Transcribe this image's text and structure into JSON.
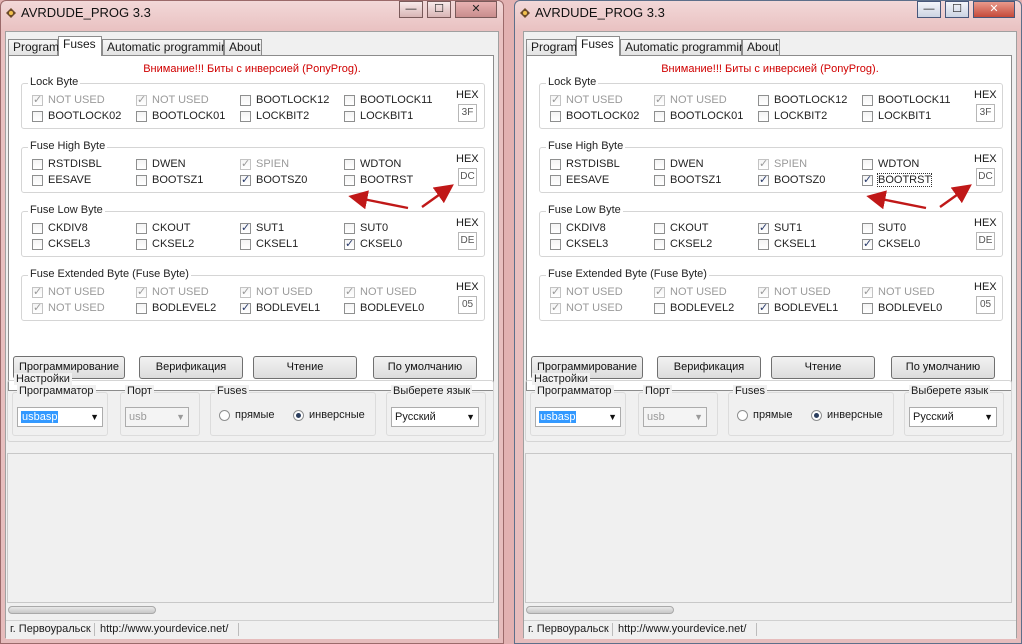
{
  "window": {
    "title": "AVRDUDE_PROG 3.3",
    "minimize_glyph": "—",
    "maximize_glyph": "☐",
    "close_glyph": "✕"
  },
  "tabs": [
    {
      "label": "Program"
    },
    {
      "label": "Fuses"
    },
    {
      "label": "Automatic programming"
    },
    {
      "label": "About"
    }
  ],
  "fuses": {
    "warning": "Внимание!!! Биты с инверсией (PonyProg).",
    "hex_label": "HEX"
  },
  "buttons": {
    "program": "Программирование",
    "verify": "Верификация",
    "read": "Чтение",
    "default": "По умолчанию"
  },
  "settings": {
    "legend": "Настройки",
    "programmer_label": "Программатор",
    "programmer_value": "usbasp",
    "port_label": "Порт",
    "port_value": "usb",
    "fuses_label": "Fuses",
    "radio_direct": "прямые",
    "radio_inverse": "инверсные",
    "language_label": "Выберете язык",
    "language_value": "Русский"
  },
  "status": {
    "city": "г. Первоуральск",
    "url": "http://www.yourdevice.net/"
  },
  "windows": [
    {
      "groups": [
        {
          "legend": "Lock Byte",
          "hex": "3F",
          "bits": [
            {
              "label": "NOT USED",
              "checked": true,
              "disabled": true
            },
            {
              "label": "NOT USED",
              "checked": true,
              "disabled": true
            },
            {
              "label": "BOOTLOCK12",
              "checked": false,
              "disabled": false
            },
            {
              "label": "BOOTLOCK11",
              "checked": false,
              "disabled": false
            },
            {
              "label": "BOOTLOCK02",
              "checked": false,
              "disabled": false
            },
            {
              "label": "BOOTLOCK01",
              "checked": false,
              "disabled": false
            },
            {
              "label": "LOCKBIT2",
              "checked": false,
              "disabled": false
            },
            {
              "label": "LOCKBIT1",
              "checked": false,
              "disabled": false
            }
          ]
        },
        {
          "legend": "Fuse High Byte",
          "hex": "DC",
          "bits": [
            {
              "label": "RSTDISBL",
              "checked": false,
              "disabled": false
            },
            {
              "label": "DWEN",
              "checked": false,
              "disabled": false
            },
            {
              "label": "SPIEN",
              "checked": true,
              "disabled": true
            },
            {
              "label": "WDTON",
              "checked": false,
              "disabled": false
            },
            {
              "label": "EESAVE",
              "checked": false,
              "disabled": false
            },
            {
              "label": "BOOTSZ1",
              "checked": false,
              "disabled": false
            },
            {
              "label": "BOOTSZ0",
              "checked": true,
              "disabled": false
            },
            {
              "label": "BOOTRST",
              "checked": false,
              "disabled": false
            }
          ]
        },
        {
          "legend": "Fuse Low Byte",
          "hex": "DE",
          "bits": [
            {
              "label": "CKDIV8",
              "checked": false,
              "disabled": false
            },
            {
              "label": "CKOUT",
              "checked": false,
              "disabled": false
            },
            {
              "label": "SUT1",
              "checked": true,
              "disabled": false
            },
            {
              "label": "SUT0",
              "checked": false,
              "disabled": false
            },
            {
              "label": "CKSEL3",
              "checked": false,
              "disabled": false
            },
            {
              "label": "CKSEL2",
              "checked": false,
              "disabled": false
            },
            {
              "label": "CKSEL1",
              "checked": false,
              "disabled": false
            },
            {
              "label": "CKSEL0",
              "checked": true,
              "disabled": false
            }
          ]
        },
        {
          "legend": "Fuse Extended Byte (Fuse Byte)",
          "hex": "05",
          "bits": [
            {
              "label": "NOT USED",
              "checked": true,
              "disabled": true
            },
            {
              "label": "NOT USED",
              "checked": true,
              "disabled": true
            },
            {
              "label": "NOT USED",
              "checked": true,
              "disabled": true
            },
            {
              "label": "NOT USED",
              "checked": true,
              "disabled": true
            },
            {
              "label": "NOT USED",
              "checked": true,
              "disabled": true
            },
            {
              "label": "BODLEVEL2",
              "checked": false,
              "disabled": false
            },
            {
              "label": "BODLEVEL1",
              "checked": true,
              "disabled": false
            },
            {
              "label": "BODLEVEL0",
              "checked": false,
              "disabled": false
            }
          ]
        }
      ]
    },
    {
      "groups": [
        {
          "legend": "Lock Byte",
          "hex": "3F",
          "bits": [
            {
              "label": "NOT USED",
              "checked": true,
              "disabled": true
            },
            {
              "label": "NOT USED",
              "checked": true,
              "disabled": true
            },
            {
              "label": "BOOTLOCK12",
              "checked": false,
              "disabled": false
            },
            {
              "label": "BOOTLOCK11",
              "checked": false,
              "disabled": false
            },
            {
              "label": "BOOTLOCK02",
              "checked": false,
              "disabled": false
            },
            {
              "label": "BOOTLOCK01",
              "checked": false,
              "disabled": false
            },
            {
              "label": "LOCKBIT2",
              "checked": false,
              "disabled": false
            },
            {
              "label": "LOCKBIT1",
              "checked": false,
              "disabled": false
            }
          ]
        },
        {
          "legend": "Fuse High Byte",
          "hex": "DC",
          "bits": [
            {
              "label": "RSTDISBL",
              "checked": false,
              "disabled": false
            },
            {
              "label": "DWEN",
              "checked": false,
              "disabled": false
            },
            {
              "label": "SPIEN",
              "checked": true,
              "disabled": true
            },
            {
              "label": "WDTON",
              "checked": false,
              "disabled": false
            },
            {
              "label": "EESAVE",
              "checked": false,
              "disabled": false
            },
            {
              "label": "BOOTSZ1",
              "checked": false,
              "disabled": false
            },
            {
              "label": "BOOTSZ0",
              "checked": true,
              "disabled": false
            },
            {
              "label": "BOOTRST",
              "checked": true,
              "disabled": false,
              "focused": true
            }
          ]
        },
        {
          "legend": "Fuse Low Byte",
          "hex": "DE",
          "bits": [
            {
              "label": "CKDIV8",
              "checked": false,
              "disabled": false
            },
            {
              "label": "CKOUT",
              "checked": false,
              "disabled": false
            },
            {
              "label": "SUT1",
              "checked": true,
              "disabled": false
            },
            {
              "label": "SUT0",
              "checked": false,
              "disabled": false
            },
            {
              "label": "CKSEL3",
              "checked": false,
              "disabled": false
            },
            {
              "label": "CKSEL2",
              "checked": false,
              "disabled": false
            },
            {
              "label": "CKSEL1",
              "checked": false,
              "disabled": false
            },
            {
              "label": "CKSEL0",
              "checked": true,
              "disabled": false
            }
          ]
        },
        {
          "legend": "Fuse Extended Byte (Fuse Byte)",
          "hex": "05",
          "bits": [
            {
              "label": "NOT USED",
              "checked": true,
              "disabled": true
            },
            {
              "label": "NOT USED",
              "checked": true,
              "disabled": true
            },
            {
              "label": "NOT USED",
              "checked": true,
              "disabled": true
            },
            {
              "label": "NOT USED",
              "checked": true,
              "disabled": true
            },
            {
              "label": "NOT USED",
              "checked": true,
              "disabled": true
            },
            {
              "label": "BODLEVEL2",
              "checked": false,
              "disabled": false
            },
            {
              "label": "BODLEVEL1",
              "checked": true,
              "disabled": false
            },
            {
              "label": "BODLEVEL0",
              "checked": false,
              "disabled": false
            }
          ]
        }
      ]
    }
  ],
  "colors": {
    "warning": "#d00000",
    "annotation_arrow": "#c01818",
    "selection": "#3399ff"
  }
}
